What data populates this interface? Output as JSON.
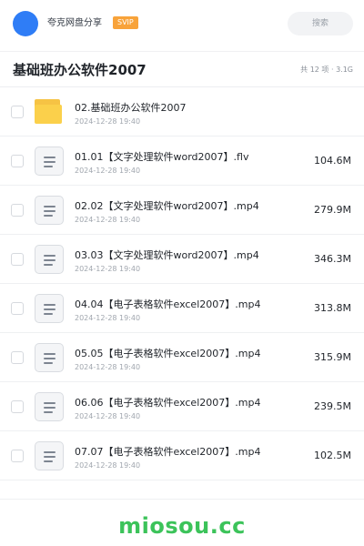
{
  "header": {
    "user_name": "夸克网盘分享",
    "badge": "SVIP",
    "search_placeholder": "搜索"
  },
  "folder": {
    "title": "基础班办公软件2007",
    "meta": "共 12 项 · 3.1G"
  },
  "items": [
    {
      "name": "02.基础班办公软件2007",
      "date": "2024-12-28 19:40",
      "size": "",
      "type": "folder-icon"
    },
    {
      "name": "01.01【文字处理软件word2007】.flv",
      "date": "2024-12-28 19:40",
      "size": "104.6M",
      "type": "video-file-icon"
    },
    {
      "name": "02.02【文字处理软件word2007】.mp4",
      "date": "2024-12-28 19:40",
      "size": "279.9M",
      "type": "video-file-icon"
    },
    {
      "name": "03.03【文字处理软件word2007】.mp4",
      "date": "2024-12-28 19:40",
      "size": "346.3M",
      "type": "video-file-icon"
    },
    {
      "name": "04.04【电子表格软件excel2007】.mp4",
      "date": "2024-12-28 19:40",
      "size": "313.8M",
      "type": "video-file-icon"
    },
    {
      "name": "05.05【电子表格软件excel2007】.mp4",
      "date": "2024-12-28 19:40",
      "size": "315.9M",
      "type": "video-file-icon"
    },
    {
      "name": "06.06【电子表格软件excel2007】.mp4",
      "date": "2024-12-28 19:40",
      "size": "239.5M",
      "type": "video-file-icon"
    },
    {
      "name": "07.07【电子表格软件excel2007】.mp4",
      "date": "2024-12-28 19:40",
      "size": "102.5M",
      "type": "video-file-icon"
    }
  ],
  "watermark": "miosou.cc",
  "colors": {
    "accent": "#2f7df6",
    "badge": "#f8a33a",
    "folder": "#fbd04b",
    "watermark": "#3cc35a"
  }
}
